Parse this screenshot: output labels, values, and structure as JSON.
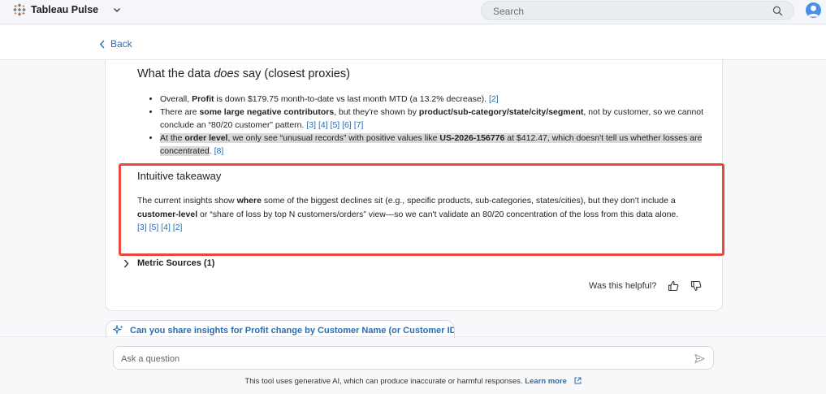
{
  "app": {
    "name": "Tableau Pulse"
  },
  "search": {
    "placeholder": "Search"
  },
  "nav": {
    "back_label": "Back"
  },
  "content": {
    "section_prefix": "What the data ",
    "section_em": "does",
    "section_suffix": " say (closest proxies)",
    "bullet1": {
      "t1": "Overall, ",
      "b1": "Profit",
      "t2": " is down $179.75 month-to-date vs last month MTD (a 13.2% decrease). ",
      "refs": "[2]"
    },
    "bullet2": {
      "t1": "There are ",
      "b1": "some large negative contributors",
      "t2": ", but they're shown by ",
      "b2": "product/sub-category/state/city/segment",
      "t3": ", not by customer, so we cannot conclude an “80/20 customer” pattern. ",
      "refs": "[3] [4] [5] [6] [7]"
    },
    "bullet3": {
      "t1": "At the ",
      "b1": "order level",
      "t2": ", we only see “unusual records” with positive values like ",
      "b2": "US-2026-156776",
      "t3": " at $412.47, which doesn't tell us whether losses are concentrated",
      "t4": ". ",
      "refs": "[8]"
    },
    "takeaway_heading": "Intuitive takeaway",
    "takeaway": {
      "t1": "The current insights show ",
      "b1": "where",
      "t2": " some of the biggest declines sit (e.g., specific products, sub-categories, states/cities), but they don't include a ",
      "b2": "customer-level",
      "t3": " or “share of loss by top N customers/orders” view—so we can't validate an 80/20 concentration of the loss from this data alone.",
      "refs": "[3] [5] [4] [2]"
    },
    "metric_sources_label": "Metric Sources (1)",
    "helpful_label": "Was this helpful?"
  },
  "suggestion": {
    "label": "Can you share insights for Profit change by Customer Name (or Customer ID)?"
  },
  "ask": {
    "placeholder": "Ask a question"
  },
  "footer": {
    "disclaimer": "This tool uses generative AI, which can produce inaccurate or harmful responses. ",
    "learn_more": "Learn more"
  },
  "colors": {
    "accent": "#2a6db3",
    "highlight_box": "#e8473d",
    "avatar": "#4b8ee8"
  }
}
